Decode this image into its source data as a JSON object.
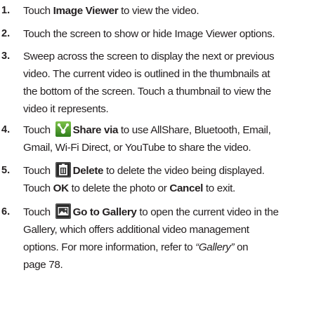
{
  "steps": [
    {
      "number": "1.",
      "lines": [
        {
          "pre": "Touch ",
          "bold": "Image Viewer",
          "post": " to view the video."
        }
      ]
    },
    {
      "number": "2.",
      "lines": [
        {
          "text": "Touch the screen to show or hide Image Viewer options."
        }
      ]
    },
    {
      "number": "3.",
      "lines": [
        {
          "text": "Sweep across the screen to display the next or previous"
        },
        {
          "text": "video. The current video is outlined in the thumbnails at"
        },
        {
          "text": "the bottom of the screen. Touch a thumbnail to view the"
        },
        {
          "text": "video it represents."
        }
      ]
    },
    {
      "number": "4.",
      "icon": "share-via-icon",
      "lines": [
        {
          "pre": "Touch ",
          "bold": "Share via",
          "post": " to use AllShare, Bluetooth, Email,"
        },
        {
          "text": "Gmail, Wi-Fi Direct, or YouTube to share the video."
        }
      ]
    },
    {
      "number": "5.",
      "icon": "delete-icon",
      "lines": [
        {
          "pre": "Touch ",
          "bold": "Delete",
          "post": " to delete the video being displayed."
        },
        {
          "pre": "Touch ",
          "bold": "OK",
          "mid": " to delete the photo or ",
          "bold2": "Cancel",
          "post": " to exit."
        }
      ]
    },
    {
      "number": "6.",
      "icon": "gallery-icon",
      "lines": [
        {
          "pre": "Touch ",
          "bold": "Go to Gallery",
          "post": " to open the current video in the"
        },
        {
          "text": "Gallery, which offers additional video management"
        },
        {
          "pre": "options. For more information, refer to ",
          "italic": "“Gallery”",
          "post": " on"
        },
        {
          "text": "page 78."
        }
      ]
    }
  ]
}
